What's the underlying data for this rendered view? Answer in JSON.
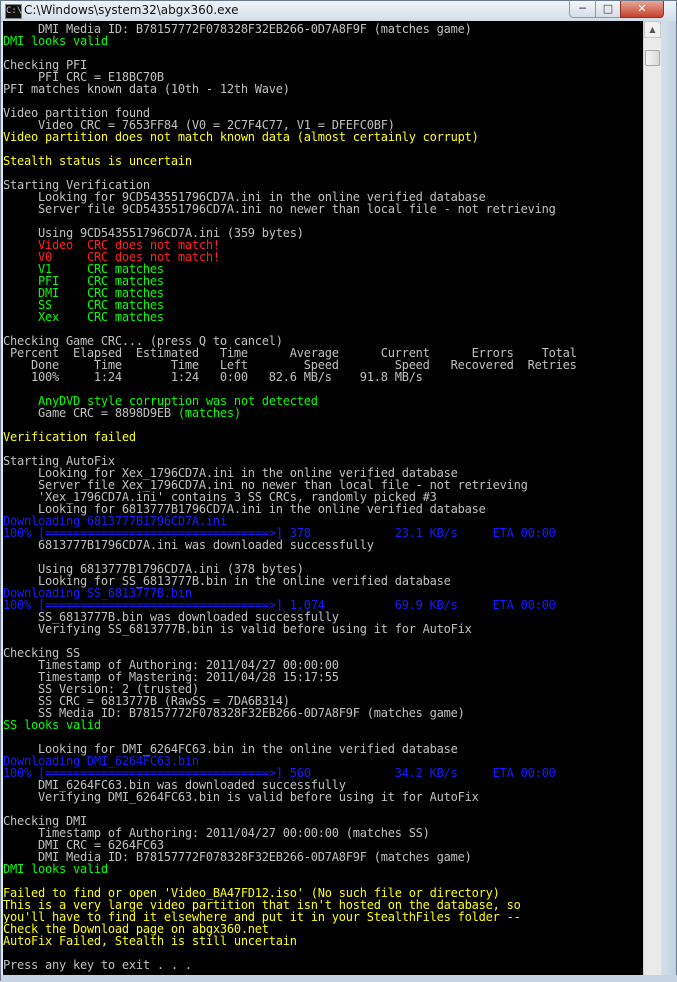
{
  "window": {
    "title": "C:\\Windows\\system32\\abgx360.exe",
    "icon_text": "C:\\",
    "controls": {
      "minimize": "─",
      "maximize": "□",
      "close": "✕"
    }
  },
  "scrollbar": {
    "up_arrow": "▲"
  },
  "colors": {
    "default": "#c0c0c0",
    "yellow": "#ffff00",
    "green": "#00ff00",
    "red": "#ff2020",
    "blue": "#1a1aff",
    "background": "#000000"
  },
  "console_lines": [
    [
      [
        "w",
        "     DMI Media ID: B78157772F078328F32EB266-0D7A8F9F (matches game)"
      ]
    ],
    [
      [
        "g",
        "DMI looks valid"
      ]
    ],
    [
      [
        "w",
        ""
      ]
    ],
    [
      [
        "w",
        "Checking PFI"
      ]
    ],
    [
      [
        "w",
        "     PFI CRC = E18BC70B"
      ]
    ],
    [
      [
        "w",
        "PFI matches known data (10th - 12th Wave)"
      ]
    ],
    [
      [
        "w",
        ""
      ]
    ],
    [
      [
        "w",
        "Video partition found"
      ]
    ],
    [
      [
        "w",
        "     Video CRC = 7653FF84 (V0 = 2C7F4C77, V1 = DFEFC0BF)"
      ]
    ],
    [
      [
        "y",
        "Video partition does not match known data (almost certainly corrupt)"
      ]
    ],
    [
      [
        "w",
        ""
      ]
    ],
    [
      [
        "y",
        "Stealth status is uncertain"
      ]
    ],
    [
      [
        "w",
        ""
      ]
    ],
    [
      [
        "w",
        "Starting Verification"
      ]
    ],
    [
      [
        "w",
        "     Looking for 9CD543551796CD7A.ini in the online verified database"
      ]
    ],
    [
      [
        "w",
        "     Server file 9CD543551796CD7A.ini no newer than local file - not retrieving"
      ]
    ],
    [
      [
        "w",
        ""
      ]
    ],
    [
      [
        "w",
        "     Using 9CD543551796CD7A.ini (359 bytes)"
      ]
    ],
    [
      [
        "w",
        "     "
      ],
      [
        "r",
        "Video  CRC does not match!"
      ]
    ],
    [
      [
        "w",
        "     "
      ],
      [
        "r",
        "V0     CRC does not match!"
      ]
    ],
    [
      [
        "w",
        "     "
      ],
      [
        "g",
        "V1     CRC matches"
      ]
    ],
    [
      [
        "w",
        "     "
      ],
      [
        "g",
        "PFI    CRC matches"
      ]
    ],
    [
      [
        "w",
        "     "
      ],
      [
        "g",
        "DMI    CRC matches"
      ]
    ],
    [
      [
        "w",
        "     "
      ],
      [
        "g",
        "SS     CRC matches"
      ]
    ],
    [
      [
        "w",
        "     "
      ],
      [
        "g",
        "Xex    CRC matches"
      ]
    ],
    [
      [
        "w",
        ""
      ]
    ],
    [
      [
        "w",
        "Checking Game CRC... (press Q to cancel)"
      ]
    ],
    [
      [
        "w",
        " Percent  Elapsed  Estimated   Time      Average      Current      Errors    Total"
      ]
    ],
    [
      [
        "w",
        "    Done     Time       Time   Left        Speed        Speed   Recovered  Retries"
      ]
    ],
    [
      [
        "w",
        "    100%     1:24       1:24   0:00   82.6 MB/s    91.8 MB/s"
      ]
    ],
    [
      [
        "w",
        ""
      ]
    ],
    [
      [
        "w",
        "     "
      ],
      [
        "g",
        "AnyDVD style corruption was not detected"
      ]
    ],
    [
      [
        "w",
        "     Game CRC = 8898D9EB "
      ],
      [
        "g",
        "(matches)"
      ]
    ],
    [
      [
        "w",
        ""
      ]
    ],
    [
      [
        "y",
        "Verification failed"
      ]
    ],
    [
      [
        "w",
        ""
      ]
    ],
    [
      [
        "w",
        "Starting AutoFix"
      ]
    ],
    [
      [
        "w",
        "     Looking for Xex_1796CD7A.ini in the online verified database"
      ]
    ],
    [
      [
        "w",
        "     Server file Xex_1796CD7A.ini no newer than local file - not retrieving"
      ]
    ],
    [
      [
        "w",
        "     'Xex_1796CD7A.ini' contains 3 SS CRCs, randomly picked #3"
      ]
    ],
    [
      [
        "w",
        "     Looking for 6813777B1796CD7A.ini in the online verified database"
      ]
    ],
    [
      [
        "b",
        "Downloading 6813777B1796CD7A.ini"
      ]
    ],
    [
      [
        "b",
        "100% [================================>] 378            23.1 KB/s     ETA 00:00"
      ]
    ],
    [
      [
        "w",
        "     6813777B1796CD7A.ini was downloaded successfully"
      ]
    ],
    [
      [
        "w",
        ""
      ]
    ],
    [
      [
        "w",
        "     Using 6813777B1796CD7A.ini (378 bytes)"
      ]
    ],
    [
      [
        "w",
        "     Looking for SS_6813777B.bin in the online verified database"
      ]
    ],
    [
      [
        "b",
        "Downloading SS_6813777B.bin"
      ]
    ],
    [
      [
        "b",
        "100% [================================>] 1,074          69.9 KB/s     ETA 00:00"
      ]
    ],
    [
      [
        "w",
        "     SS_6813777B.bin was downloaded successfully"
      ]
    ],
    [
      [
        "w",
        "     Verifying SS_6813777B.bin is valid before using it for AutoFix"
      ]
    ],
    [
      [
        "w",
        ""
      ]
    ],
    [
      [
        "w",
        "Checking SS"
      ]
    ],
    [
      [
        "w",
        "     Timestamp of Authoring: 2011/04/27 00:00:00"
      ]
    ],
    [
      [
        "w",
        "     Timestamp of Mastering: 2011/04/28 15:17:55"
      ]
    ],
    [
      [
        "w",
        "     SS Version: 2 (trusted)"
      ]
    ],
    [
      [
        "w",
        "     SS CRC = 6813777B (RawSS = 7DA6B314)"
      ]
    ],
    [
      [
        "w",
        "     SS Media ID: B78157772F078328F32EB266-0D7A8F9F (matches game)"
      ]
    ],
    [
      [
        "g",
        "SS looks valid"
      ]
    ],
    [
      [
        "w",
        ""
      ]
    ],
    [
      [
        "w",
        "     Looking for DMI_6264FC63.bin in the online verified database"
      ]
    ],
    [
      [
        "b",
        "Downloading DMI_6264FC63.bin"
      ]
    ],
    [
      [
        "b",
        "100% [================================>] 560            34.2 KB/s     ETA 00:00"
      ]
    ],
    [
      [
        "w",
        "     DMI_6264FC63.bin was downloaded successfully"
      ]
    ],
    [
      [
        "w",
        "     Verifying DMI_6264FC63.bin is valid before using it for AutoFix"
      ]
    ],
    [
      [
        "w",
        ""
      ]
    ],
    [
      [
        "w",
        "Checking DMI"
      ]
    ],
    [
      [
        "w",
        "     Timestamp of Authoring: 2011/04/27 00:00:00 (matches SS)"
      ]
    ],
    [
      [
        "w",
        "     DMI CRC = 6264FC63"
      ]
    ],
    [
      [
        "w",
        "     DMI Media ID: B78157772F078328F32EB266-0D7A8F9F (matches game)"
      ]
    ],
    [
      [
        "g",
        "DMI looks valid"
      ]
    ],
    [
      [
        "w",
        ""
      ]
    ],
    [
      [
        "y",
        "Failed to find or open 'Video_BA47FD12.iso' (No such file or directory)"
      ]
    ],
    [
      [
        "y",
        "This is a very large video partition that isn't hosted on the database, so"
      ]
    ],
    [
      [
        "y",
        "you'll have to find it elsewhere and put it in your StealthFiles folder --"
      ]
    ],
    [
      [
        "y",
        "Check the Download page on abgx360.net"
      ]
    ],
    [
      [
        "y",
        "AutoFix Failed, Stealth is still uncertain"
      ]
    ],
    [
      [
        "w",
        ""
      ]
    ],
    [
      [
        "w",
        "Press any key to exit . . ."
      ]
    ]
  ]
}
